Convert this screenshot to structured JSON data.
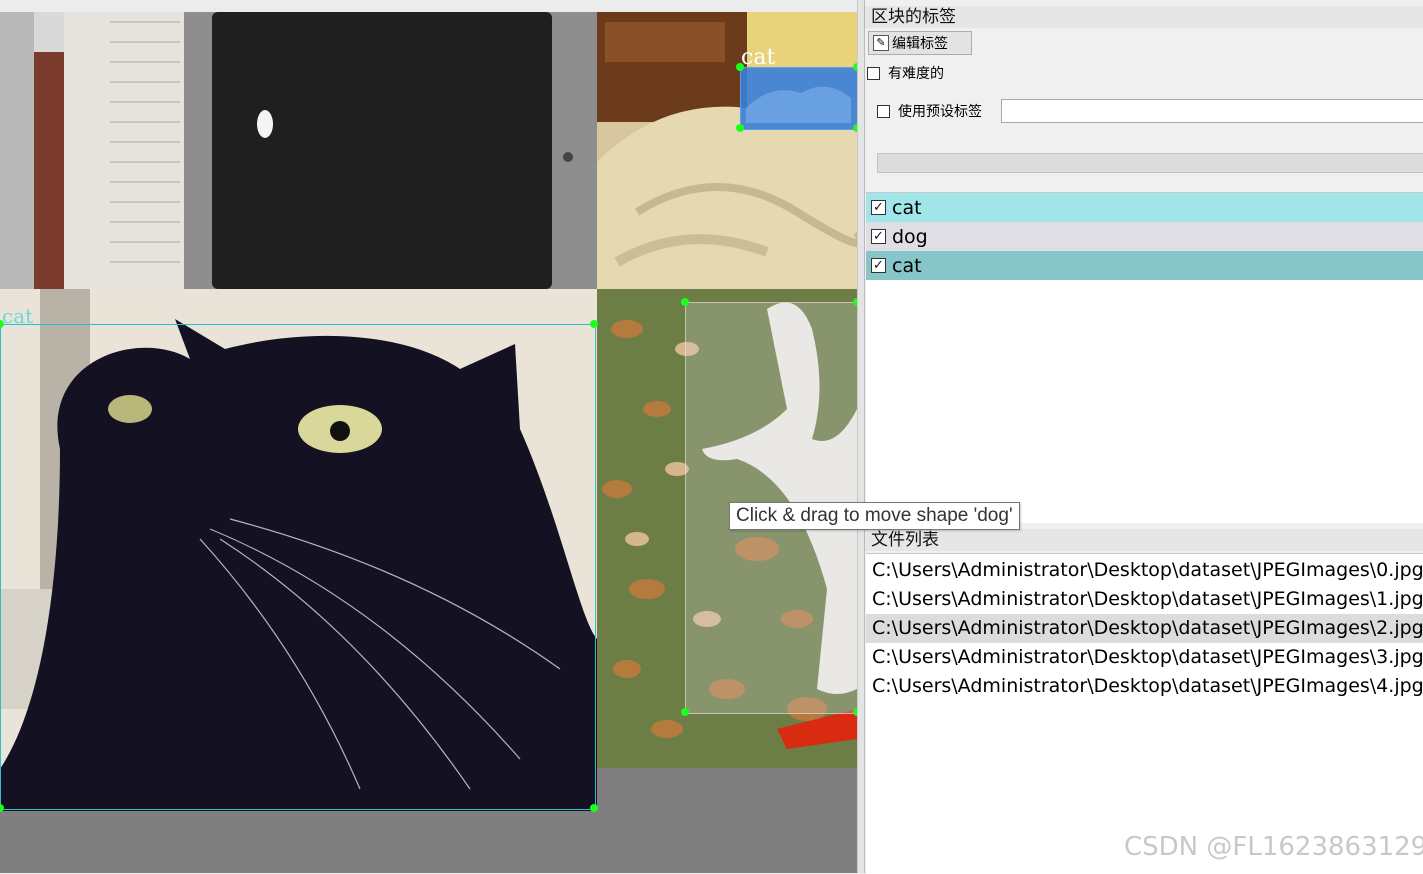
{
  "canvas": {
    "shapes": [
      {
        "label": "cat",
        "selected": true
      },
      {
        "label": "cat",
        "selected": false
      },
      {
        "label": "dog",
        "selected": false
      }
    ],
    "tooltip": "Click & drag to move shape 'dog'"
  },
  "labels_dock": {
    "title": "区块的标签",
    "edit_button": "编辑标签",
    "difficult_label": "有难度的",
    "use_default_label": "使用预设标签",
    "default_label_value": "",
    "items": [
      {
        "text": "cat",
        "checked": true,
        "highlight": "#a0e6e8"
      },
      {
        "text": "dog",
        "checked": true,
        "highlight": "#dedee4"
      },
      {
        "text": "cat",
        "checked": true,
        "highlight": "#86c6c9"
      }
    ]
  },
  "files_dock": {
    "title": "文件列表",
    "files": [
      "C:\\Users\\Administrator\\Desktop\\dataset\\JPEGImages\\0.jpg",
      "C:\\Users\\Administrator\\Desktop\\dataset\\JPEGImages\\1.jpg",
      "C:\\Users\\Administrator\\Desktop\\dataset\\JPEGImages\\2.jpg",
      "C:\\Users\\Administrator\\Desktop\\dataset\\JPEGImages\\3.jpg",
      "C:\\Users\\Administrator\\Desktop\\dataset\\JPEGImages\\4.jpg"
    ],
    "selected_index": 2
  },
  "watermark": "CSDN @FL1623863129",
  "colors": {
    "handle": "#1cff1c",
    "selected_box_fill": "#3a7fd8",
    "cat_box_line": "#2bc0c8"
  }
}
